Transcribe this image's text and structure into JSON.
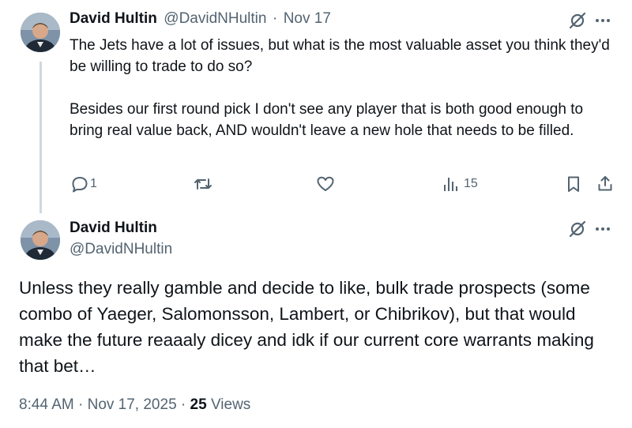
{
  "tweet1": {
    "author_name": "David Hultin",
    "handle": "@DavidNHultin",
    "separator": "·",
    "date": "Nov 17",
    "paragraph1": "The Jets have a lot of issues, but what is the most valuable asset you think they'd be willing to trade to do so?",
    "paragraph2": "Besides our first round pick I don't see any player that is both good enough to bring real value back, AND  wouldn't leave a new hole that needs to be filled.",
    "reply_count": "1",
    "view_count": "15"
  },
  "tweet2": {
    "author_name": "David Hultin",
    "handle": "@DavidNHultin",
    "body": "Unless they really gamble and decide to like, bulk trade prospects (some combo of Yaeger, Salomonsson, Lambert, or Chibrikov), but that would make the future reaaaly dicey and idk if our current core warrants making that bet…",
    "time": "8:44 AM",
    "date": "Nov 17, 2025",
    "views_count": "25",
    "views_label": "Views",
    "separator": "·"
  },
  "icons": {
    "reply": "reply-icon",
    "retweet": "retweet-icon",
    "like": "heart-icon",
    "views": "views-icon",
    "bookmark": "bookmark-icon",
    "share": "share-icon",
    "grok": "grok-icon",
    "more": "more-icon"
  },
  "colors": {
    "text": "#0f1419",
    "muted": "#536471",
    "thread_line": "#cfd9de",
    "background": "#ffffff"
  }
}
